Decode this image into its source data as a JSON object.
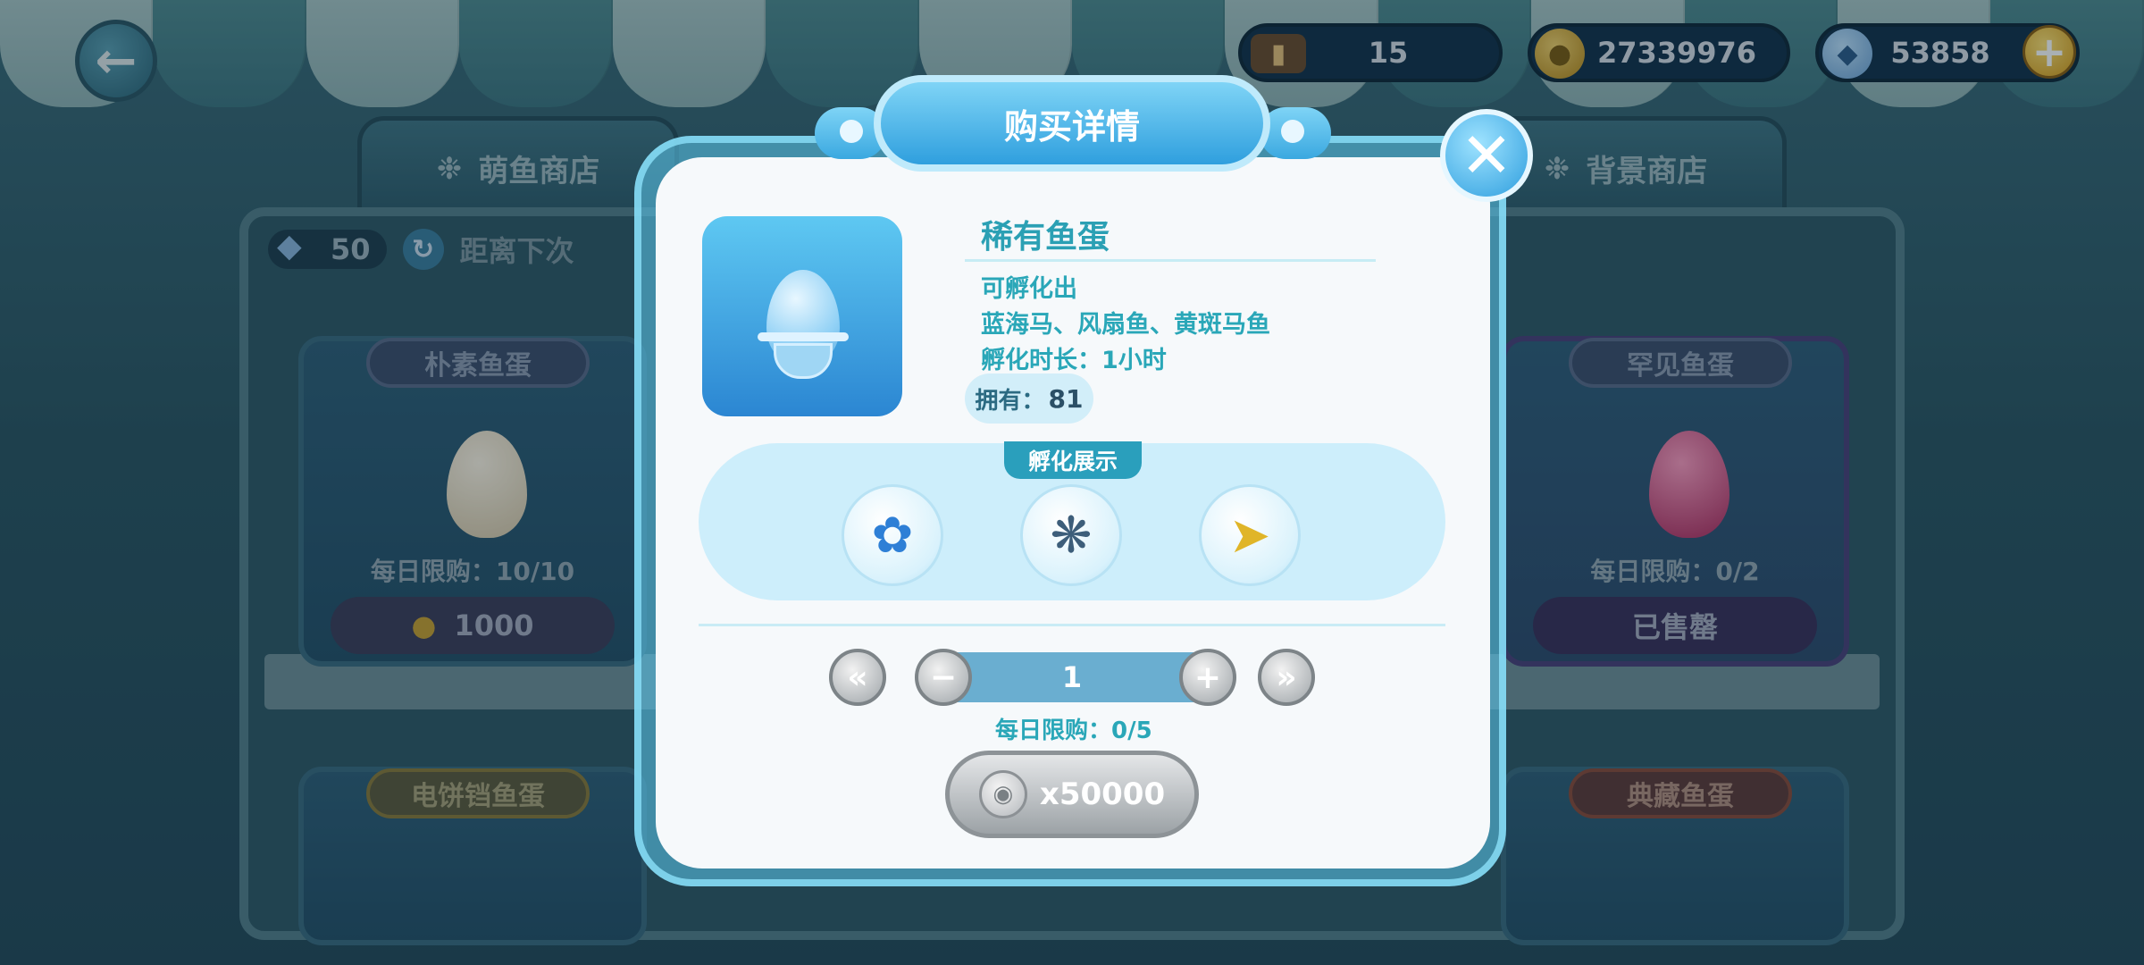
{
  "header": {
    "back_icon": "arrow-left-icon",
    "ticket_value": "15",
    "coin_value": "27339976",
    "gem_value": "53858",
    "add_icon": "plus-icon"
  },
  "tabs": {
    "fish_shop": "萌鱼商店",
    "background_shop": "背景商店"
  },
  "shelf_bar": {
    "gem_count": "50",
    "refresh_text": "距离下次"
  },
  "shop_cards": [
    {
      "title": "朴素鱼蛋",
      "limit": "每日限购：10/10",
      "price": "1000"
    },
    {
      "title": "罕见鱼蛋",
      "limit": "每日限购：0/2",
      "price": "已售罄"
    },
    {
      "title": "电饼铛鱼蛋"
    },
    {
      "title": "典藏鱼蛋"
    }
  ],
  "modal": {
    "title": "购买详情",
    "item_name": "稀有鱼蛋",
    "hatch_label": "可孵化出",
    "hatch_fish": "蓝海马、风扇鱼、黄斑马鱼",
    "hatch_duration": "孵化时长：1小时",
    "owned_label": "拥有：",
    "owned_count": "81",
    "showcase_label": "孵化展示",
    "quantity": "1",
    "daily_limit": "每日限购：0/5",
    "price": "x50000"
  },
  "colors": {
    "accent": "#2ba0b4",
    "modal_bg": "#f6f9fb",
    "title_blue": "#2f9fde"
  }
}
